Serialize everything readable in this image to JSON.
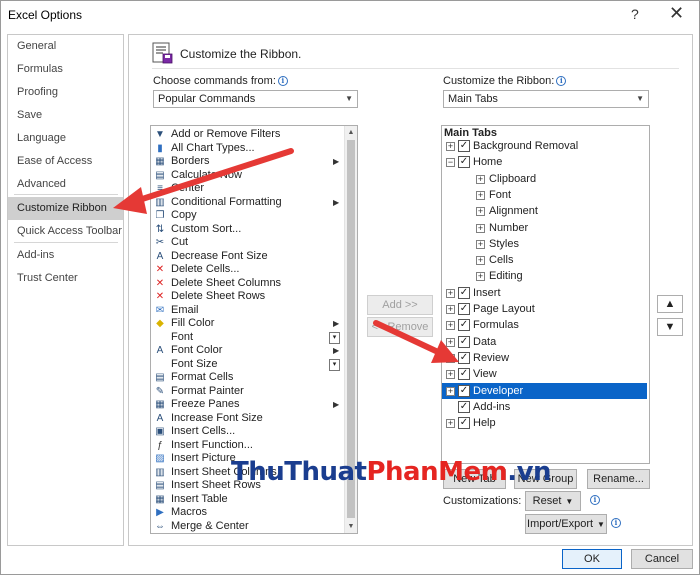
{
  "window": {
    "title": "Excel Options",
    "help_icon": "question-mark",
    "close_icon": "x-close"
  },
  "nav": {
    "items": [
      {
        "label": "General"
      },
      {
        "label": "Formulas"
      },
      {
        "label": "Proofing"
      },
      {
        "label": "Save"
      },
      {
        "label": "Language"
      },
      {
        "label": "Ease of Access"
      },
      {
        "label": "Advanced"
      },
      {
        "label": "Customize Ribbon"
      },
      {
        "label": "Quick Access Toolbar"
      },
      {
        "label": "Add-ins"
      },
      {
        "label": "Trust Center"
      }
    ],
    "selected": "Customize Ribbon"
  },
  "header": {
    "title": "Customize the Ribbon."
  },
  "left": {
    "label": "Choose commands from:",
    "select_value": "Popular Commands",
    "commands": [
      {
        "label": "Add or Remove Filters",
        "icon": "filter-icon"
      },
      {
        "label": "All Chart Types...",
        "icon": "chart-icon"
      },
      {
        "label": "Borders",
        "icon": "borders-icon",
        "submenu": true
      },
      {
        "label": "Calculate Now",
        "icon": "calculator-icon"
      },
      {
        "label": "Center",
        "icon": "center-icon"
      },
      {
        "label": "Conditional Formatting",
        "icon": "conditional-formatting-icon",
        "submenu": true
      },
      {
        "label": "Copy",
        "icon": "copy-icon"
      },
      {
        "label": "Custom Sort...",
        "icon": "sort-icon"
      },
      {
        "label": "Cut",
        "icon": "scissors-icon"
      },
      {
        "label": "Decrease Font Size",
        "icon": "decrease-font-icon"
      },
      {
        "label": "Delete Cells...",
        "icon": "delete-cells-icon"
      },
      {
        "label": "Delete Sheet Columns",
        "icon": "delete-columns-icon"
      },
      {
        "label": "Delete Sheet Rows",
        "icon": "delete-rows-icon"
      },
      {
        "label": "Email",
        "icon": "email-icon"
      },
      {
        "label": "Fill Color",
        "icon": "fill-color-icon",
        "submenu": true
      },
      {
        "label": "Font",
        "icon": "",
        "dropdown": true
      },
      {
        "label": "Font Color",
        "icon": "font-color-icon",
        "submenu": true
      },
      {
        "label": "Font Size",
        "icon": "",
        "dropdown": true
      },
      {
        "label": "Format Cells",
        "icon": "format-cells-icon"
      },
      {
        "label": "Format Painter",
        "icon": "format-painter-icon"
      },
      {
        "label": "Freeze Panes",
        "icon": "freeze-panes-icon",
        "submenu": true
      },
      {
        "label": "Increase Font Size",
        "icon": "increase-font-icon"
      },
      {
        "label": "Insert Cells...",
        "icon": "insert-cells-icon"
      },
      {
        "label": "Insert Function...",
        "icon": "function-icon"
      },
      {
        "label": "Insert Picture",
        "icon": "picture-icon"
      },
      {
        "label": "Insert Sheet Columns",
        "icon": "insert-columns-icon"
      },
      {
        "label": "Insert Sheet Rows",
        "icon": "insert-rows-icon"
      },
      {
        "label": "Insert Table",
        "icon": "table-icon"
      },
      {
        "label": "Macros",
        "icon": "macros-icon"
      },
      {
        "label": "Merge & Center",
        "icon": "merge-center-icon"
      }
    ]
  },
  "middle": {
    "add_label": "Add >>",
    "remove_label": "<< Remove"
  },
  "right": {
    "label": "Customize the Ribbon:",
    "select_value": "Main Tabs",
    "tree_header": "Main Tabs",
    "tree": [
      {
        "label": "Background Removal",
        "level": 0,
        "checked": true
      },
      {
        "label": "Home",
        "level": 0,
        "checked": true,
        "expanded": true
      },
      {
        "label": "Clipboard",
        "level": 1
      },
      {
        "label": "Font",
        "level": 1
      },
      {
        "label": "Alignment",
        "level": 1
      },
      {
        "label": "Number",
        "level": 1
      },
      {
        "label": "Styles",
        "level": 1
      },
      {
        "label": "Cells",
        "level": 1
      },
      {
        "label": "Editing",
        "level": 1
      },
      {
        "label": "Insert",
        "level": 0,
        "checked": true
      },
      {
        "label": "Page Layout",
        "level": 0,
        "checked": true
      },
      {
        "label": "Formulas",
        "level": 0,
        "checked": true
      },
      {
        "label": "Data",
        "level": 0,
        "checked": true
      },
      {
        "label": "Review",
        "level": 0,
        "checked": true
      },
      {
        "label": "View",
        "level": 0,
        "checked": true
      },
      {
        "label": "Developer",
        "level": 0,
        "checked": true,
        "selected": true
      },
      {
        "label": "Add-ins",
        "level": 0,
        "checked": true,
        "no_expander": true
      },
      {
        "label": "Help",
        "level": 0,
        "checked": true
      }
    ],
    "new_tab_label": "New Tab",
    "new_group_label": "New Group",
    "rename_label": "Rename...",
    "customizations_label": "Customizations:",
    "reset_label": "Reset",
    "import_export_label": "Import/Export",
    "move_up_icon": "triangle-up",
    "move_down_icon": "triangle-down"
  },
  "footer": {
    "ok_label": "OK",
    "cancel_label": "Cancel"
  },
  "watermark": {
    "part1": "ThuThuat",
    "part2": "PhanMem",
    "part3": ".vn"
  },
  "annotation_color": "#e53935",
  "selection_color": "#0a64c8"
}
